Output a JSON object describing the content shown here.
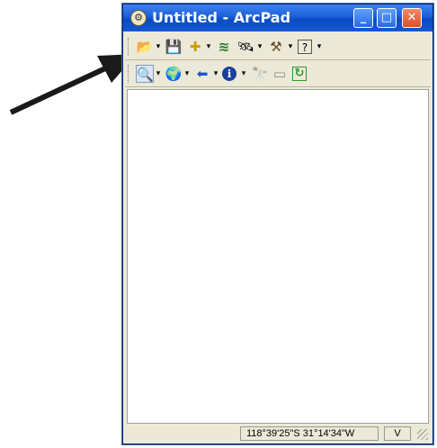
{
  "window": {
    "title": "Untitled - ArcPad",
    "controls": {
      "minimize": "_",
      "maximize": "□",
      "close": "✕"
    }
  },
  "toolbar_main": {
    "items": [
      {
        "name": "open-icon",
        "glyph": "📂",
        "has_dropdown": true
      },
      {
        "name": "save-icon",
        "glyph": "💾",
        "has_dropdown": false
      },
      {
        "name": "add-layer-icon",
        "glyph": "✚",
        "color": "#c8a000",
        "has_dropdown": true
      },
      {
        "name": "layers-icon",
        "glyph": "≋",
        "has_dropdown": false
      },
      {
        "name": "gps-icon",
        "glyph": "🛰",
        "has_dropdown": true
      },
      {
        "name": "tools-icon",
        "glyph": "⚒",
        "has_dropdown": true
      },
      {
        "name": "help-icon",
        "glyph": "?",
        "has_dropdown": true
      }
    ],
    "dropdown_glyph": "▾"
  },
  "toolbar_browse": {
    "items": [
      {
        "name": "zoom-in-icon",
        "glyph": "🔍",
        "pressed": true,
        "has_dropdown": true
      },
      {
        "name": "full-extent-icon",
        "glyph": "🌍",
        "has_dropdown": true
      },
      {
        "name": "back-arrow-icon",
        "glyph": "⬅",
        "color": "#1a56c8",
        "has_dropdown": true
      },
      {
        "name": "identify-icon",
        "glyph": "ℹ",
        "color": "#1a3fa0",
        "has_dropdown": true
      },
      {
        "name": "find-icon",
        "glyph": "🔭",
        "disabled": true
      },
      {
        "name": "select-icon",
        "glyph": "▭",
        "disabled": true
      },
      {
        "name": "refresh-icon",
        "glyph": "↻",
        "color": "#2a9a2a"
      }
    ]
  },
  "status": {
    "coordinates": "118°39'25\"S 31°14'34\"W",
    "mode": "V"
  },
  "colors": {
    "titlebar": "#1d5fd6",
    "chrome": "#ece9d8",
    "arrow": "#1a1a1a"
  }
}
